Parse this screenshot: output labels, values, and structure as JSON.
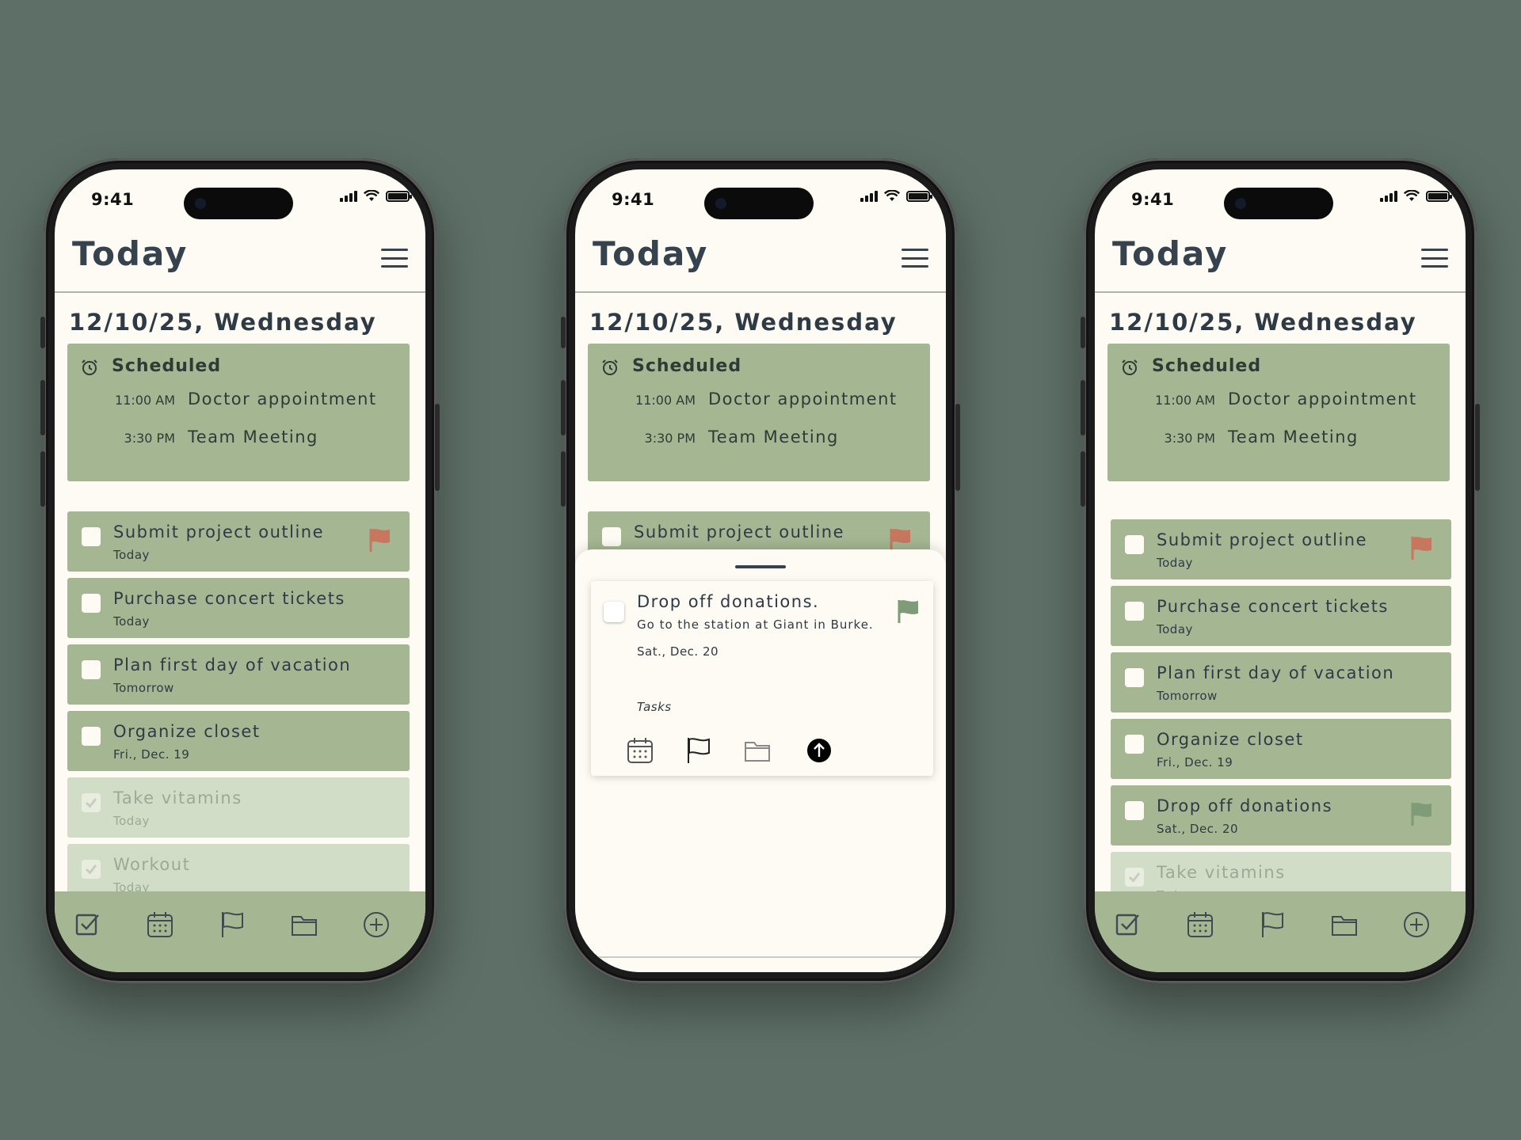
{
  "colors": {
    "background": "#5d6f66",
    "card": "#a4b792",
    "card_done": "#d2ddc7",
    "screen": "#fdfbf3",
    "text": "#2e3a44",
    "flag_red": "#c7775e",
    "flag_green": "#7f9b78"
  },
  "status": {
    "time": "9:41"
  },
  "header": {
    "title": "Today"
  },
  "date_heading": "12/10/25, Wednesday",
  "scheduled": {
    "title": "Scheduled",
    "events": [
      {
        "time": "11:00 AM",
        "name": "Doctor appointment"
      },
      {
        "time": "3:30 PM",
        "name": "Team Meeting"
      }
    ]
  },
  "phone1": {
    "tasks": [
      {
        "title": "Submit project outline",
        "sub": "Today",
        "done": false,
        "flag": "red"
      },
      {
        "title": "Purchase concert tickets",
        "sub": "Today",
        "done": false
      },
      {
        "title": "Plan first day of vacation",
        "sub": "Tomorrow",
        "done": false
      },
      {
        "title": "Organize closet",
        "sub": "Fri., Dec. 19",
        "done": false
      },
      {
        "title": "Take vitamins",
        "sub": "Today",
        "done": true
      },
      {
        "title": "Workout",
        "sub": "Today",
        "done": true
      }
    ]
  },
  "phone2": {
    "peek_task": {
      "title": "Submit project outline",
      "flag": "red"
    },
    "compose": {
      "title": "Drop off donations.",
      "note": "Go to the station at Giant in Burke.",
      "date": "Sat., Dec. 20",
      "list": "Tasks"
    },
    "tools": [
      "calendar-icon",
      "flag-icon",
      "folder-icon",
      "send-icon"
    ]
  },
  "phone3": {
    "tasks": [
      {
        "title": "Submit project outline",
        "sub": "Today",
        "done": false,
        "flag": "red"
      },
      {
        "title": "Purchase concert tickets",
        "sub": "Today",
        "done": false
      },
      {
        "title": "Plan first day of vacation",
        "sub": "Tomorrow",
        "done": false
      },
      {
        "title": "Organize closet",
        "sub": "Fri., Dec. 19",
        "done": false
      },
      {
        "title": "Drop off donations",
        "sub": "Sat., Dec. 20",
        "done": false,
        "flag": "green"
      },
      {
        "title": "Take vitamins",
        "sub": "Today",
        "done": true
      }
    ]
  },
  "tabbar": [
    "checkbox-icon",
    "calendar-icon",
    "flag-icon",
    "folder-icon",
    "add-icon"
  ]
}
